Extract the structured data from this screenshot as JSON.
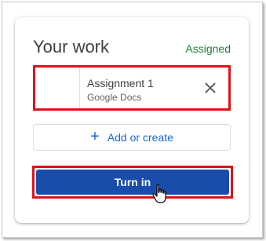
{
  "card": {
    "title": "Your work",
    "status": "Assigned",
    "status_color": "#188038"
  },
  "attachment": {
    "name": "Assignment 1",
    "type": "Google Docs",
    "remove_icon": "close-icon"
  },
  "add_button": {
    "label": "Add or create",
    "icon": "plus-icon"
  },
  "turn_in_button": {
    "label": "Turn in",
    "color": "#1a4cab"
  },
  "highlight_color": "#e0111b",
  "pointer": {
    "icon": "hand-pointer-icon"
  }
}
